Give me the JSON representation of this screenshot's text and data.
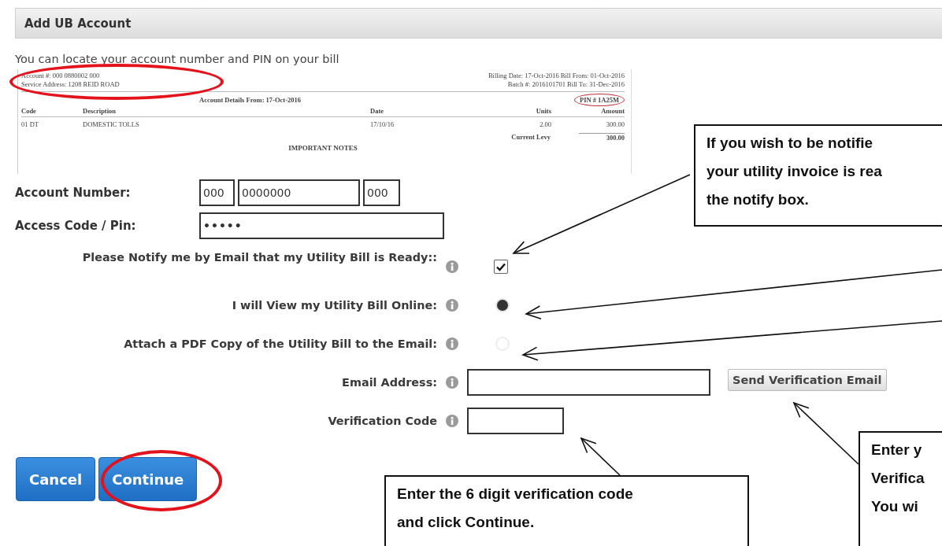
{
  "panel": {
    "title": "Add UB Account"
  },
  "intro": "You can locate your account number and PIN on your bill",
  "bill": {
    "account_line": "Account #: 000 0880002 000",
    "service_address": "Service Address: 1208 REID ROAD",
    "billing_line": "Billing Date: 17-Oct-2016 Bill From: 01-Oct-2016",
    "batch_line": "Batch #: 2016101701 Bill To: 31-Dec-2016",
    "details_heading": "Account Details From: 17-Oct-2016",
    "pin": "PIN # 1A25M",
    "columns": [
      "Code",
      "Description",
      "Date",
      "Units",
      "Amount"
    ],
    "rows": [
      [
        "01 DT",
        "DOMESTIC TOLLS",
        "17/10/16",
        "2.00",
        "300.00"
      ]
    ],
    "total_label": "Current Levy",
    "total_value": "300.00",
    "notes_heading": "IMPORTANT NOTES"
  },
  "account_number": {
    "label": "Account Number:",
    "parts": [
      "000",
      "0000000",
      "000"
    ]
  },
  "access_code": {
    "label": "Access Code / Pin:",
    "value": "•••••"
  },
  "options": [
    {
      "kind": "checkbox",
      "label": "Please Notify me by Email that my Utility Bill is Ready::",
      "checked": true
    },
    {
      "kind": "radio",
      "label": "I will View my Utility Bill Online:",
      "selected": true
    },
    {
      "kind": "radio",
      "label": "Attach a PDF Copy of the Utility Bill to the Email:",
      "selected": false
    }
  ],
  "email": {
    "label": "Email Address:",
    "button": "Send Verification Email"
  },
  "verification": {
    "label": "Verification Code"
  },
  "buttons": [
    {
      "label": "Cancel"
    },
    {
      "label": "Continue"
    }
  ],
  "callouts": [
    {
      "lines": [
        "If you wish to be notifie",
        "your utility invoice is rea",
        "the notify box."
      ]
    },
    {
      "lines": [
        "Enter the 6 digit verification code",
        "and click Continue."
      ]
    },
    {
      "lines": [
        "Enter y",
        "Verifica",
        "You wi"
      ]
    }
  ]
}
